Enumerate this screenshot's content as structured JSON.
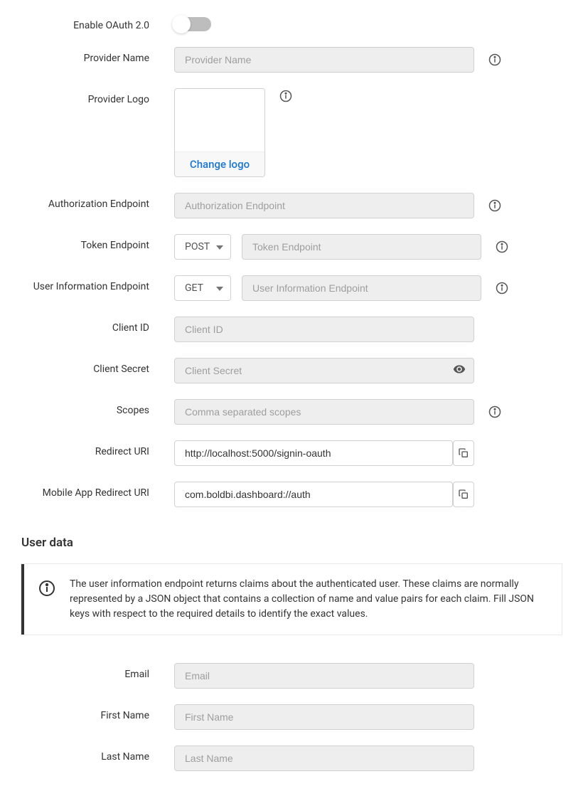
{
  "labels": {
    "enable_oauth": "Enable OAuth 2.0",
    "provider_name": "Provider Name",
    "provider_logo": "Provider Logo",
    "change_logo": "Change logo",
    "auth_endpoint": "Authorization Endpoint",
    "token_endpoint": "Token Endpoint",
    "user_info_endpoint": "User Information Endpoint",
    "client_id": "Client ID",
    "client_secret": "Client Secret",
    "scopes": "Scopes",
    "redirect_uri": "Redirect URI",
    "mobile_redirect_uri": "Mobile App Redirect URI",
    "user_data_section": "User data",
    "email": "Email",
    "first_name": "First Name",
    "last_name": "Last Name"
  },
  "placeholders": {
    "provider_name": "Provider Name",
    "auth_endpoint": "Authorization Endpoint",
    "token_endpoint": "Token Endpoint",
    "user_info_endpoint": "User Information Endpoint",
    "client_id": "Client ID",
    "client_secret": "Client Secret",
    "scopes": "Comma separated scopes",
    "email": "Email",
    "first_name": "First Name",
    "last_name": "Last Name"
  },
  "values": {
    "token_method": "POST",
    "userinfo_method": "GET",
    "redirect_uri": "http://localhost:5000/signin-oauth",
    "mobile_redirect_uri": "com.boldbi.dashboard://auth"
  },
  "note": "The user information endpoint returns claims about the authenticated user. These claims are normally represented by a JSON object that contains a collection of name and value pairs for each claim. Fill JSON keys with respect to the required details to identify the exact values."
}
